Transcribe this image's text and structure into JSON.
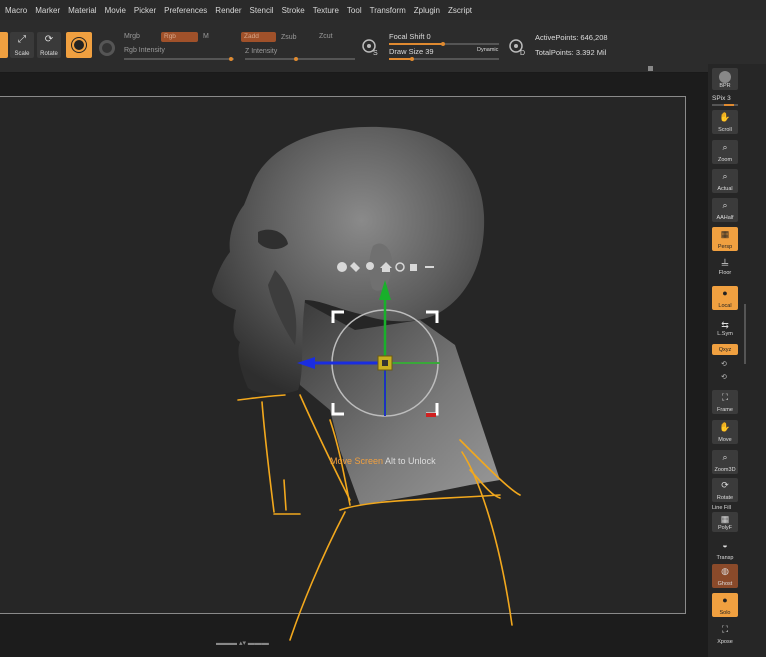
{
  "menu": [
    "Macro",
    "Marker",
    "Material",
    "Movie",
    "Picker",
    "Preferences",
    "Render",
    "Stencil",
    "Stroke",
    "Texture",
    "Tool",
    "Transform",
    "Zplugin",
    "Zscript"
  ],
  "toolbar": {
    "scale_label": "Scale",
    "rotate_label": "Rotate",
    "mrgb": "Mrgb",
    "rgb": "Rgb",
    "m": "M",
    "zadd": "Zadd",
    "zsub": "Zsub",
    "zcut": "Zcut",
    "rgb_intensity": "Rgb Intensity",
    "z_intensity": "Z Intensity",
    "focal_shift": "Focal Shift 0",
    "draw_size": "Draw Size 39",
    "dynamic": "Dynamic",
    "active_points": "ActivePoints: 646,208",
    "total_points": "TotalPoints: 3.392 Mil",
    "s_label": "S",
    "d_label": "D"
  },
  "rightbar": {
    "spix": "SPix 3",
    "bpr": "BPR",
    "items": [
      "Scroll",
      "Zoom",
      "Actual",
      "AAHalf",
      "Persp",
      "Floor",
      "Local",
      "L.Sym",
      "Qxyz",
      "Frame",
      "Move",
      "Zoom3D",
      "Rotate",
      "Line Fill",
      "PolyF",
      "Transp",
      "Ghost",
      "Solo",
      "Xpose"
    ]
  },
  "hud": {
    "move_screen": "Move Screen",
    "alt_unlock": "Alt to Unlock"
  },
  "colors": {
    "accent": "#f0a040",
    "stroke": "#f2a81d",
    "axis_x": "#1a2de0",
    "axis_y": "#19b02b",
    "axis_z": "#3aa83a"
  }
}
